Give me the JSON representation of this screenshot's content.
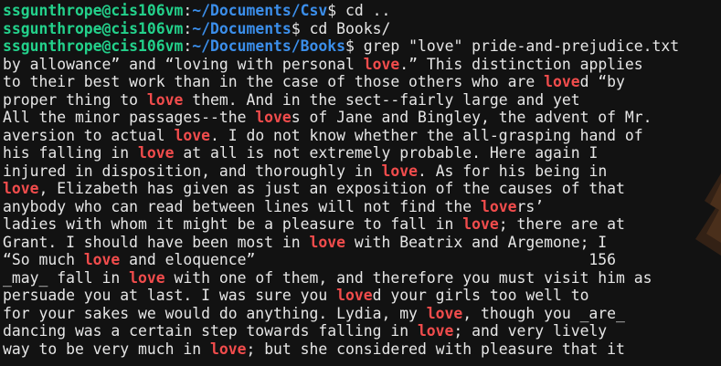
{
  "terminal": {
    "colors": {
      "background": "#121212",
      "text": "#e6e6e6",
      "user": "#23d18b",
      "path": "#3b8eea",
      "match": "#f14c4c"
    },
    "lines": [
      {
        "type": "prompt",
        "user": "ssgunthrope@cis106vm",
        "sep": ":",
        "path": "~/Documents/Csv",
        "sym": "$ ",
        "cmd": "cd .."
      },
      {
        "type": "prompt",
        "user": "ssgunthrope@cis106vm",
        "sep": ":",
        "path": "~/Documents",
        "sym": "$ ",
        "cmd": "cd Books/"
      },
      {
        "type": "prompt",
        "user": "ssgunthrope@cis106vm",
        "sep": ":",
        "path": "~/Documents/Books",
        "sym": "$ ",
        "cmd": "grep \"love\" pride-and-prejudice.txt"
      },
      {
        "type": "output",
        "segments": [
          {
            "t": "by allowance” and “loving with personal "
          },
          {
            "t": "love",
            "m": true
          },
          {
            "t": ".” This distinction applies"
          }
        ]
      },
      {
        "type": "output",
        "segments": [
          {
            "t": "to their best work than in the case of those others who are "
          },
          {
            "t": "love",
            "m": true
          },
          {
            "t": "d “by"
          }
        ]
      },
      {
        "type": "output",
        "segments": [
          {
            "t": "proper thing to "
          },
          {
            "t": "love",
            "m": true
          },
          {
            "t": " them. And in the sect--fairly large and yet"
          }
        ]
      },
      {
        "type": "output",
        "segments": [
          {
            "t": "All the minor passages--the "
          },
          {
            "t": "love",
            "m": true
          },
          {
            "t": "s of Jane and Bingley, the advent of Mr."
          }
        ]
      },
      {
        "type": "output",
        "segments": [
          {
            "t": "aversion to actual "
          },
          {
            "t": "love",
            "m": true
          },
          {
            "t": ". I do not know whether the all-grasping hand of"
          }
        ]
      },
      {
        "type": "output",
        "segments": [
          {
            "t": "his falling in "
          },
          {
            "t": "love",
            "m": true
          },
          {
            "t": " at all is not extremely probable. Here again I"
          }
        ]
      },
      {
        "type": "output",
        "segments": [
          {
            "t": "injured in disposition, and thoroughly in "
          },
          {
            "t": "love",
            "m": true
          },
          {
            "t": ". As for his being in"
          }
        ]
      },
      {
        "type": "output",
        "segments": [
          {
            "t": "love",
            "m": true
          },
          {
            "t": ", Elizabeth has given as just an exposition of the causes of that"
          }
        ]
      },
      {
        "type": "output",
        "segments": [
          {
            "t": "anybody who can read between lines will not find the "
          },
          {
            "t": "love",
            "m": true
          },
          {
            "t": "rs’"
          }
        ]
      },
      {
        "type": "output",
        "segments": [
          {
            "t": "ladies with whom it might be a pleasure to fall in "
          },
          {
            "t": "love",
            "m": true
          },
          {
            "t": "; there are at"
          }
        ]
      },
      {
        "type": "output",
        "segments": [
          {
            "t": "Grant. I should have been most in "
          },
          {
            "t": "love",
            "m": true
          },
          {
            "t": " with Beatrix and Argemone; I"
          }
        ]
      },
      {
        "type": "output",
        "segments": [
          {
            "t": "“So much "
          },
          {
            "t": "love",
            "m": true
          },
          {
            "t": " and eloquence”                                     156"
          }
        ]
      },
      {
        "type": "output",
        "segments": [
          {
            "t": "_may_ fall in "
          },
          {
            "t": "love",
            "m": true
          },
          {
            "t": " with one of them, and therefore you must visit him as"
          }
        ]
      },
      {
        "type": "output",
        "segments": [
          {
            "t": "persuade you at last. I was sure you "
          },
          {
            "t": "love",
            "m": true
          },
          {
            "t": "d your girls too well to"
          }
        ]
      },
      {
        "type": "output",
        "segments": [
          {
            "t": "for your sakes we would do anything. Lydia, my "
          },
          {
            "t": "love",
            "m": true
          },
          {
            "t": ", though you _are_"
          }
        ]
      },
      {
        "type": "output",
        "segments": [
          {
            "t": "dancing was a certain step towards falling in "
          },
          {
            "t": "love",
            "m": true
          },
          {
            "t": "; and very lively"
          }
        ]
      },
      {
        "type": "output",
        "segments": [
          {
            "t": "way to be very much in "
          },
          {
            "t": "love",
            "m": true
          },
          {
            "t": "; but she considered with pleasure that it"
          }
        ]
      }
    ]
  }
}
